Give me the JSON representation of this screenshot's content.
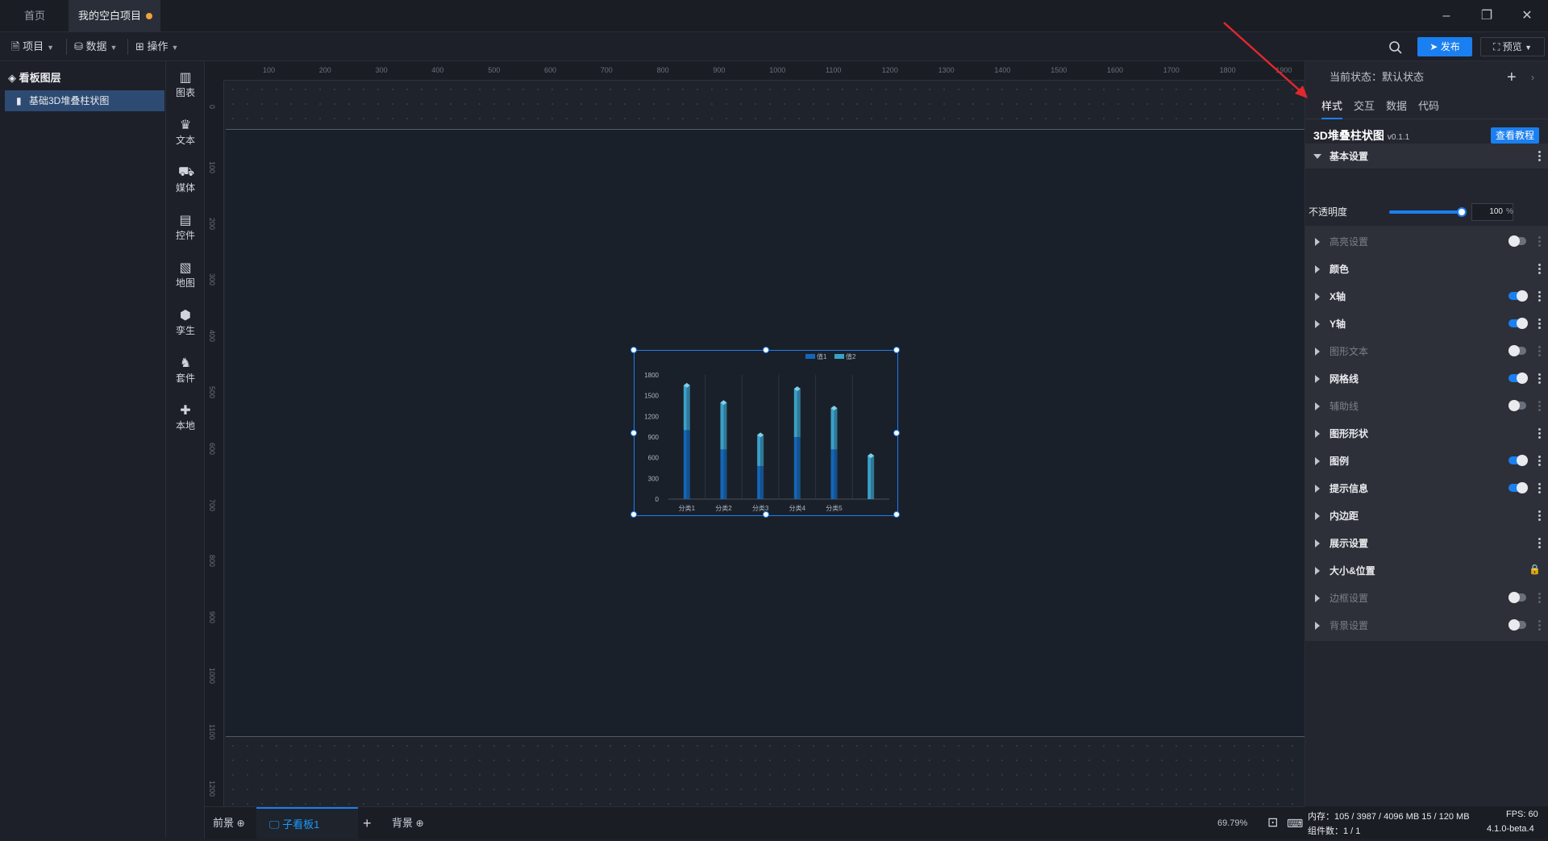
{
  "titlebar": {
    "tab_home": "首页",
    "tab_project": "我的空白项目"
  },
  "toolbar": {
    "project": "项目",
    "data": "数据",
    "operation": "操作",
    "publish": "发布",
    "preview": "预览"
  },
  "layers": {
    "title": "看板图层",
    "item": "基础3D堆叠柱状图"
  },
  "components": [
    {
      "name": "chart",
      "label": "图表"
    },
    {
      "name": "text",
      "label": "文本"
    },
    {
      "name": "media",
      "label": "媒体"
    },
    {
      "name": "control",
      "label": "控件"
    },
    {
      "name": "map",
      "label": "地图"
    },
    {
      "name": "twin",
      "label": "孪生"
    },
    {
      "name": "kit",
      "label": "套件"
    },
    {
      "name": "local",
      "label": "本地"
    }
  ],
  "ruler_h": [
    "100",
    "200",
    "300",
    "400",
    "500",
    "600",
    "700",
    "800",
    "900",
    "1000",
    "1100",
    "1200",
    "1300",
    "1400",
    "1500",
    "1600",
    "1700",
    "1800",
    "1900"
  ],
  "ruler_v": [
    "0",
    "100",
    "200",
    "300",
    "400",
    "500",
    "600",
    "700",
    "800",
    "900",
    "1000",
    "1100",
    "1200"
  ],
  "chart_data": {
    "type": "bar",
    "stacked": true,
    "categories": [
      "分类1",
      "分类2",
      "分类3",
      "分类4",
      "分类5",
      ""
    ],
    "series": [
      {
        "name": "值1",
        "values": [
          1000,
          720,
          480,
          900,
          720,
          0
        ]
      },
      {
        "name": "值2",
        "values": [
          650,
          680,
          450,
          700,
          600,
          630
        ]
      }
    ],
    "yticks": [
      "0",
      "300",
      "600",
      "900",
      "1200",
      "1500",
      "1800"
    ],
    "ylim": [
      0,
      1800
    ],
    "legend": "top-right",
    "colors": {
      "s1": "#1466b8",
      "s2": "#3aa0c8"
    }
  },
  "bottom": {
    "front": "前景",
    "subboard": "子看板1",
    "background": "背景",
    "zoom": "69.79%"
  },
  "props": {
    "state_label": "当前状态：",
    "state_value": "默认状态",
    "tabs": [
      "样式",
      "交互",
      "数据",
      "代码"
    ],
    "comp_title": "3D堆叠柱状图",
    "comp_version": "v0.1.1",
    "tutorial": "查看教程",
    "opacity_label": "不透明度",
    "opacity_value": "100",
    "opacity_unit": "%",
    "sections": [
      {
        "label": "基本设置",
        "toggle": "none",
        "disabled": false,
        "expanded": true
      },
      {
        "label": "高亮设置",
        "toggle": "off",
        "disabled": true
      },
      {
        "label": "颜色",
        "toggle": "none",
        "disabled": false
      },
      {
        "label": "X轴",
        "toggle": "on",
        "disabled": false
      },
      {
        "label": "Y轴",
        "toggle": "on",
        "disabled": false
      },
      {
        "label": "图形文本",
        "toggle": "off",
        "disabled": true
      },
      {
        "label": "网格线",
        "toggle": "on",
        "disabled": false
      },
      {
        "label": "辅助线",
        "toggle": "off",
        "disabled": true
      },
      {
        "label": "图形形状",
        "toggle": "none",
        "disabled": false
      },
      {
        "label": "图例",
        "toggle": "on",
        "disabled": false
      },
      {
        "label": "提示信息",
        "toggle": "on",
        "disabled": false
      },
      {
        "label": "内边距",
        "toggle": "none",
        "disabled": false
      },
      {
        "label": "展示设置",
        "toggle": "none",
        "disabled": false
      },
      {
        "label": "大小&位置",
        "toggle": "lock",
        "disabled": false
      },
      {
        "label": "边框设置",
        "toggle": "off",
        "disabled": true
      },
      {
        "label": "背景设置",
        "toggle": "off",
        "disabled": true
      }
    ]
  },
  "status": {
    "memory": "内存：105 / 3987 / 4096 MB  15 / 120 MB",
    "fps": "FPS:  60",
    "count": "组件数：1 / 1",
    "version": "4.1.0-beta.4"
  }
}
